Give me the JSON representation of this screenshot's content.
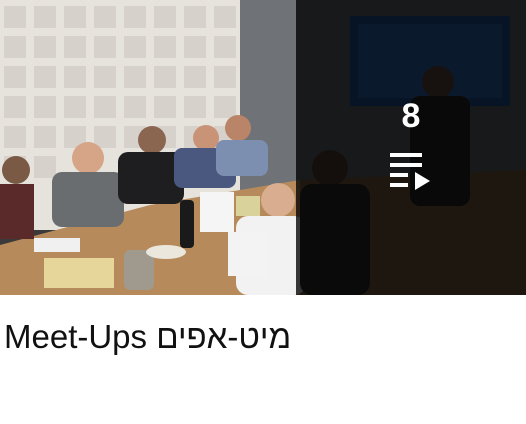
{
  "playlist": {
    "video_count": "8",
    "title": "Meet-Ups מיט-אפים",
    "thumbnail_icon": "playlist-play-icon",
    "thumbnail_description_icon": "meeting-photo"
  },
  "colors": {
    "overlay": "#000000",
    "count_text": "#ffffff",
    "title_text": "#111111"
  }
}
